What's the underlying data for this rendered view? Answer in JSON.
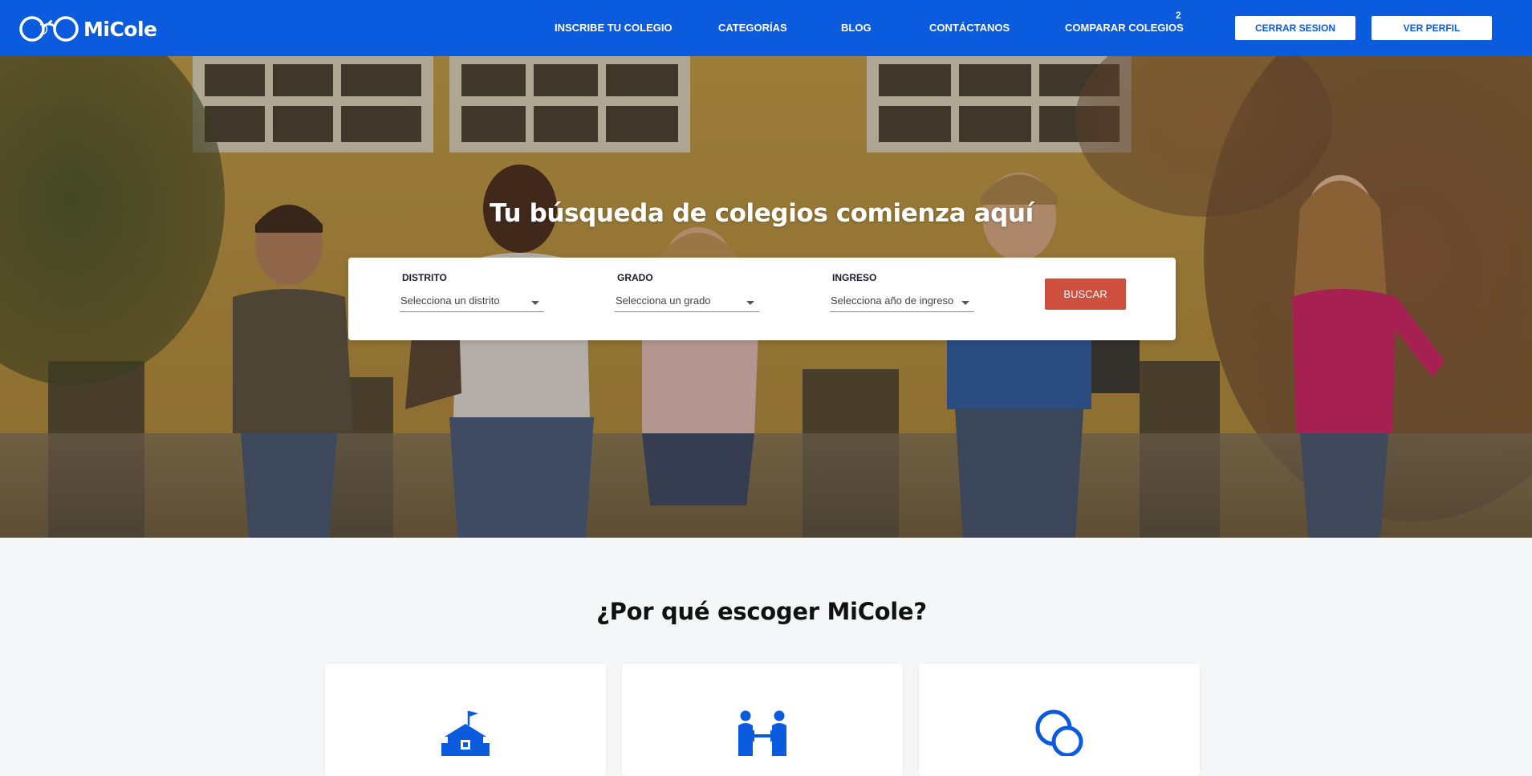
{
  "header": {
    "brand": "MiCole",
    "nav": [
      "INSCRIBE TU COLEGIO",
      "CATEGORÍAS",
      "BLOG",
      "CONTÁCTANOS",
      "COMPARAR COLEGIOS"
    ],
    "compare_count": "2",
    "logout_label": "CERRAR SESION",
    "profile_label": "VER PERFIL",
    "colors": {
      "bar": "#0b5bde",
      "button_text": "#0b5bde"
    }
  },
  "hero": {
    "title": "Tu búsqueda de colegios comienza aquí",
    "search": {
      "district_label": "DISTRITO",
      "district_placeholder": "Selecciona un distrito",
      "grade_label": "GRADO",
      "grade_placeholder": "Selecciona un grado",
      "entry_label": "INGRESO",
      "entry_placeholder": "Selecciona año de ingreso",
      "search_button": "BUSCAR",
      "button_color": "#cf4f3e"
    }
  },
  "why": {
    "title": "¿Por qué escoger MiCole?",
    "cards": [
      {
        "icon": "school-icon"
      },
      {
        "icon": "compare-people-icon"
      },
      {
        "icon": "chat-bubbles-icon"
      }
    ],
    "icon_color": "#0b5bde"
  }
}
